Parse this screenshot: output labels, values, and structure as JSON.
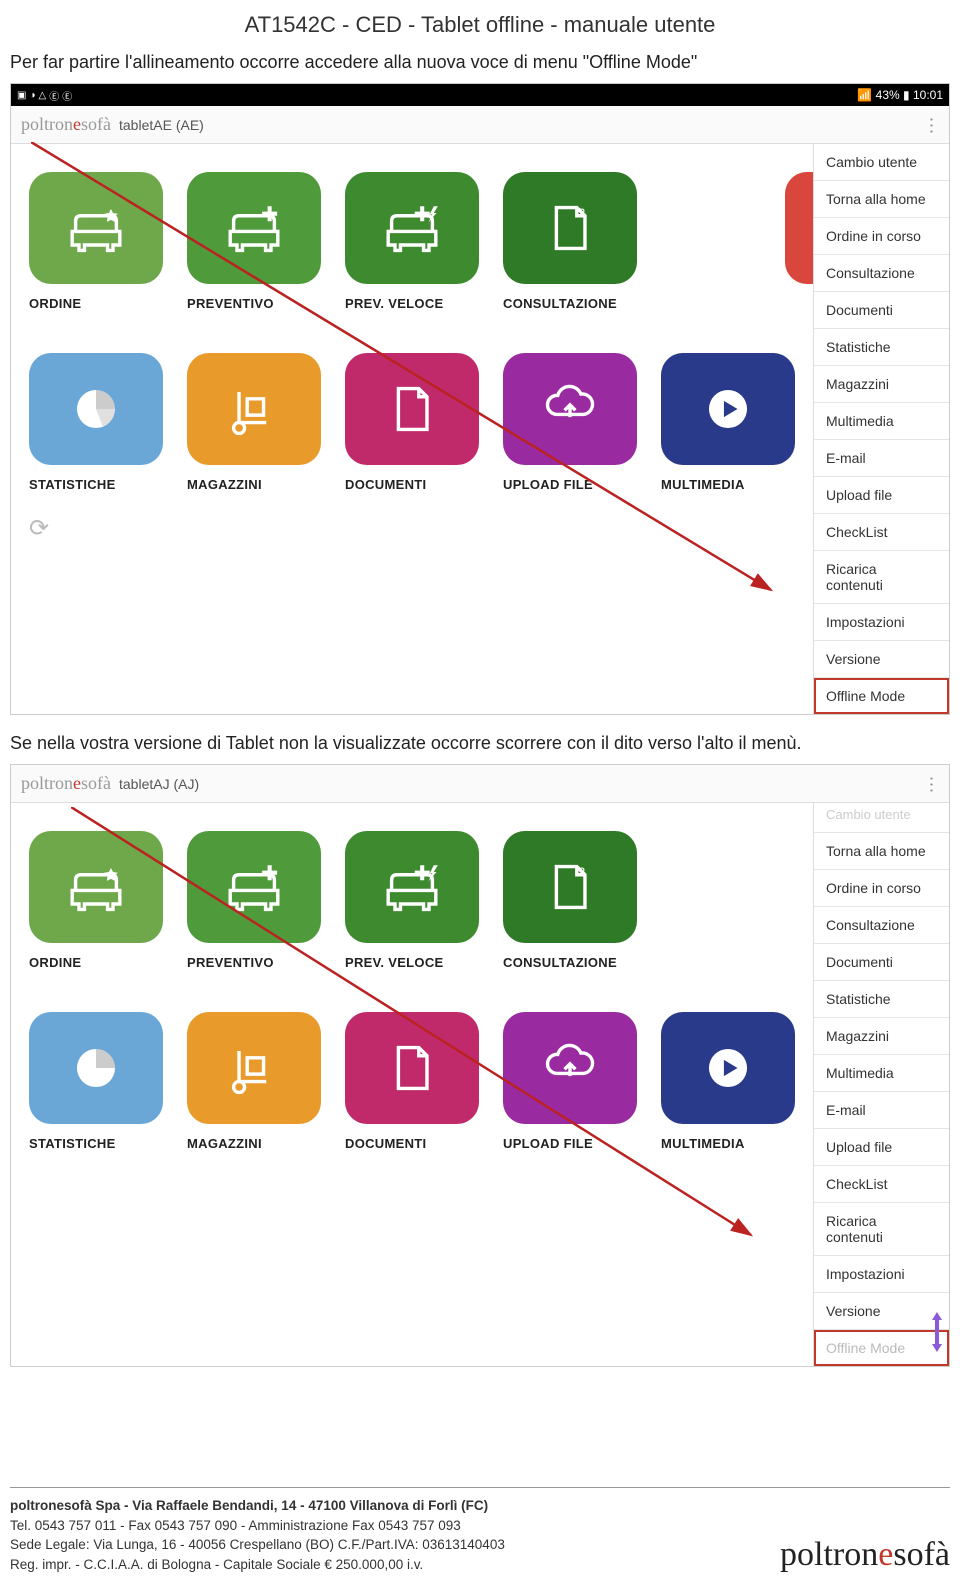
{
  "doc": {
    "title": "AT1542C - CED - Tablet offline - manuale utente",
    "para1": "Per far partire l'allineamento occorre accedere alla nuova voce di menu \"Offline Mode\"",
    "para2": "Se nella vostra versione di Tablet non la visualizzate occorre scorrere con il dito verso l'alto il menù."
  },
  "status": {
    "battery": "43%",
    "time": "10:01"
  },
  "app": {
    "logo_a": "poltron",
    "logo_b": "e",
    "logo_c": "sofà",
    "tab1": "tabletAE (AE)",
    "tab2": "tabletAJ (AJ)"
  },
  "tiles": {
    "ordine": "ORDINE",
    "preventivo": "PREVENTIVO",
    "prev_veloce": "PREV. VELOCE",
    "consultazione": "CONSULTAZIONE",
    "statistiche": "STATISTICHE",
    "magazzini": "MAGAZZINI",
    "documenti": "DOCUMENTI",
    "upload": "UPLOAD FILE",
    "multimedia": "MULTIMEDIA"
  },
  "colors": {
    "ordine": "#6fa84a",
    "preventivo": "#4f9a3a",
    "prev_veloce": "#3d8a2f",
    "consultazione": "#2f7a26",
    "statistiche": "#6aa7d6",
    "magazzini": "#e89a2a",
    "documenti": "#c12a6a",
    "upload": "#9a2aa0",
    "multimedia": "#2a3a8a"
  },
  "menu": [
    "Cambio utente",
    "Torna alla home",
    "Ordine in corso",
    "Consultazione",
    "Documenti",
    "Statistiche",
    "Magazzini",
    "Multimedia",
    "E-mail",
    "Upload file",
    "CheckList",
    "Ricarica contenuti",
    "Impostazioni",
    "Versione",
    "Offline Mode"
  ],
  "footer": {
    "l1": "poltronesofà Spa - Via Raffaele Bendandi, 14 - 47100 Villanova di Forlì (FC)",
    "l2": "Tel. 0543 757 011 - Fax 0543 757 090 - Amministrazione Fax 0543 757 093",
    "l3": "Sede Legale: Via Lunga, 16 - 40056 Crespellano (BO) C.F./Part.IVA: 03613140403",
    "l4": "Reg. impr. - C.C.I.A.A. di Bologna - Capitale Sociale € 250.000,00 i.v."
  }
}
